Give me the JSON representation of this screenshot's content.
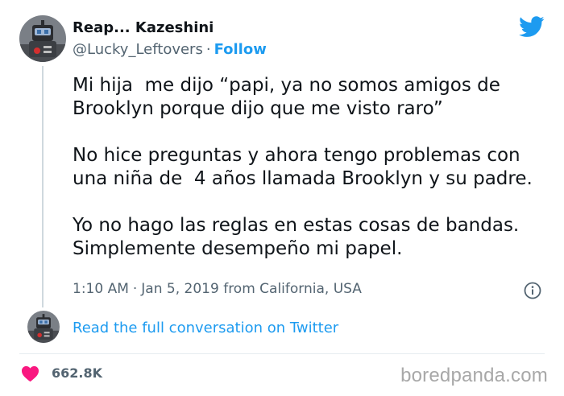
{
  "author": {
    "display_name": "Reap... Kazeshini",
    "handle": "@Lucky_Leftovers",
    "separator": "·",
    "follow_label": "Follow",
    "avatar_icon": "robot-avatar"
  },
  "brand": {
    "icon": "twitter-bird-icon",
    "color": "#1d9bf0"
  },
  "tweet": {
    "paragraphs": [
      "Mi hija  me dijo “papi, ya no somos amigos de Brooklyn porque dijo que me visto raro”",
      "No hice preguntas y ahora tengo problemas con una niña de  4 años llamada Brooklyn y su padre.",
      "Yo no hago las reglas en estas cosas de bandas. Simplemente desempeño mi papel."
    ],
    "time": "1:10 AM",
    "dot": "·",
    "date": "Jan 5, 2019",
    "location": "from California, USA"
  },
  "conversation": {
    "link_label": "Read the full conversation on Twitter"
  },
  "engagement": {
    "likes": "662.8K",
    "heart_color": "#f91880"
  },
  "watermark": {
    "text": "boredpanda.com"
  }
}
